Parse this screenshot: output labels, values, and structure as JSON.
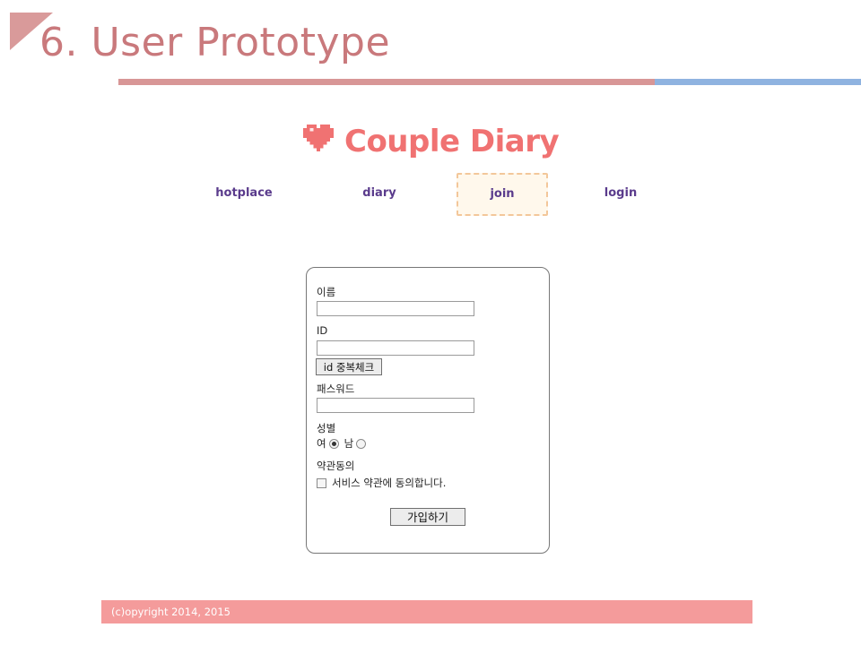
{
  "slide": {
    "title": "6. User Prototype",
    "accent_pink": "#d89696",
    "accent_blue": "#8fb3e0"
  },
  "header": {
    "logo_text": "Couple Diary",
    "logo_icon": "heart-icon",
    "logo_color": "#f07272"
  },
  "nav": {
    "items": [
      {
        "label": "hotplace"
      },
      {
        "label": "diary"
      },
      {
        "label": "join",
        "active": true
      },
      {
        "label": "login"
      }
    ]
  },
  "form": {
    "name_label": "이름",
    "name_value": "",
    "id_label": "ID",
    "id_value": "",
    "dup_check_label": "id 중복체크",
    "password_label": "패스워드",
    "password_value": "",
    "gender_label": "성별",
    "gender_female": "여",
    "gender_male": "남",
    "gender_selected": "여",
    "terms_label": "약관동의",
    "terms_text": "서비스 약관에 동의합니다.",
    "terms_checked": false,
    "submit_label": "가입하기"
  },
  "footer": {
    "copyright": "(c)opyright 2014, 2015",
    "color": "#f49b9b"
  }
}
